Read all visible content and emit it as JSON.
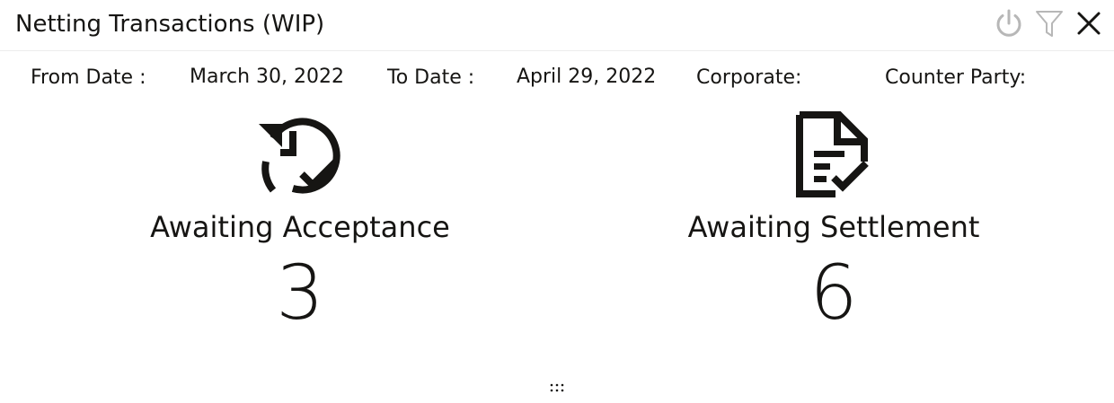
{
  "header": {
    "title": "Netting Transactions (WIP)",
    "icons": [
      "refresh-icon",
      "filter-icon",
      "close-icon"
    ]
  },
  "criteria": {
    "from_date_label": "From Date :",
    "from_date_value": "March 30, 2022",
    "to_date_label": "To Date :",
    "to_date_value": "April 29, 2022",
    "corporate_label": "Corporate:",
    "counter_party_label": "Counter Party:"
  },
  "tiles": [
    {
      "label": "Awaiting Acceptance",
      "count": "3",
      "icon": "history-check-icon"
    },
    {
      "label": "Awaiting Settlement",
      "count": "6",
      "icon": "document-check-icon"
    }
  ],
  "footer": {
    "drag_handle_icon": "drag-handle-icon"
  },
  "colors": {
    "text": "#161513",
    "icon_muted": "#b7b7b7",
    "divider": "#ececec"
  }
}
